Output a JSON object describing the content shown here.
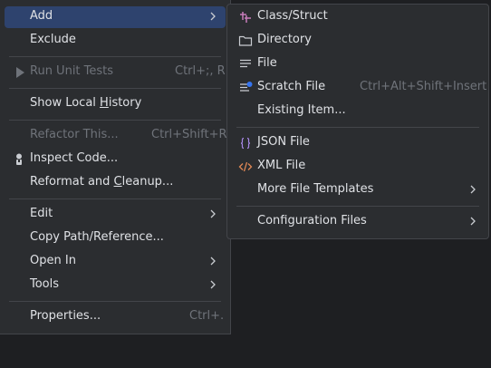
{
  "main_menu": {
    "add": "Add",
    "exclude": "Exclude",
    "run_unit_tests": "Run Unit Tests",
    "run_unit_tests_shortcut": "Ctrl+;, R",
    "show_local_history_pre": "Show Local ",
    "show_local_history_u": "H",
    "show_local_history_post": "istory",
    "refactor_this": "Refactor This...",
    "refactor_this_shortcut": "Ctrl+Shift+R",
    "inspect_code": "Inspect Code...",
    "reformat_pre": "Reformat and ",
    "reformat_u": "C",
    "reformat_post": "leanup...",
    "edit": "Edit",
    "copy_path": "Copy Path/Reference...",
    "open_in": "Open In",
    "tools": "Tools",
    "properties": "Properties...",
    "properties_shortcut": "Ctrl+."
  },
  "sub_menu": {
    "class_struct": "Class/Struct",
    "directory": "Directory",
    "file": "File",
    "scratch_file": "Scratch File",
    "scratch_file_shortcut": "Ctrl+Alt+Shift+Insert",
    "existing_item": "Existing Item...",
    "json_file": "JSON File",
    "xml_file": "XML File",
    "more_file_templates": "More File Templates",
    "configuration_files": "Configuration Files"
  },
  "icons": {
    "class_struct": "class-struct-icon",
    "directory": "folder-icon",
    "file": "file-icon",
    "scratch_file": "scratch-file-icon",
    "json_file": "json-file-icon",
    "xml_file": "xml-file-icon",
    "run": "run-icon",
    "inspect": "inspect-icon",
    "submenu": "chevron-right-icon"
  },
  "colors": {
    "background": "#2b2d30",
    "selection": "#2e436e",
    "text": "#dfe1e5",
    "disabled_text": "#6f737a",
    "separator": "#43454a",
    "class_icon": "#c77dbb",
    "json_icon": "#a889e8",
    "xml_icon": "#e08855",
    "scratch_badge": "#3574f0"
  }
}
